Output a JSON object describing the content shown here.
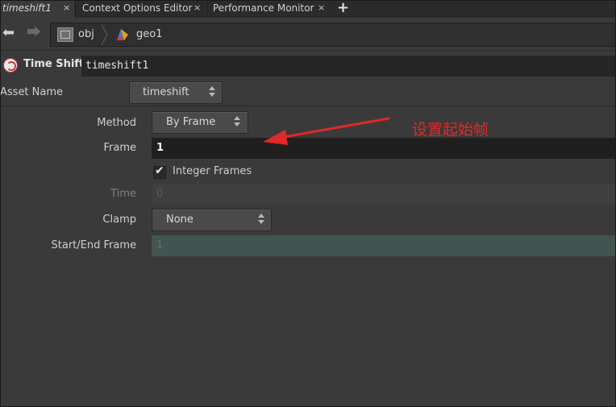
{
  "tabs": [
    {
      "label": "timeshift1",
      "active": true
    },
    {
      "label": "Context Options Editor",
      "active": false
    },
    {
      "label": "Performance Monitor",
      "active": false
    }
  ],
  "tab_close_glyph": "×",
  "add_tab_glyph": "+",
  "path": {
    "back_icon": "back-arrow-icon",
    "forward_icon": "forward-arrow-icon",
    "crumbs": [
      {
        "label": "obj",
        "icon": "obj-network-icon"
      },
      {
        "label": "geo1",
        "icon": "geometry-node-icon"
      }
    ]
  },
  "node": {
    "type_label": "Time Shift",
    "name": "timeshift1",
    "icon": "timeshift-node-icon"
  },
  "asset": {
    "label": "Asset Name",
    "value": "timeshift"
  },
  "params": {
    "method": {
      "label": "Method",
      "value": "By Frame"
    },
    "frame": {
      "label": "Frame",
      "value": "1"
    },
    "integer_frames": {
      "label": "Integer Frames",
      "checked": true
    },
    "time": {
      "label": "Time",
      "value": "0",
      "disabled": true
    },
    "clamp": {
      "label": "Clamp",
      "value": "None"
    },
    "start_end_frame": {
      "label": "Start/End Frame",
      "value": "1",
      "disabled": true
    }
  },
  "annotation": {
    "text": "设置起始帧",
    "color": "#e02828"
  },
  "colors": {
    "background": "#3a3a3a",
    "tabbar": "#2b2b2b",
    "field_dark": "#1f1f1f",
    "range_field": "#42544f"
  }
}
